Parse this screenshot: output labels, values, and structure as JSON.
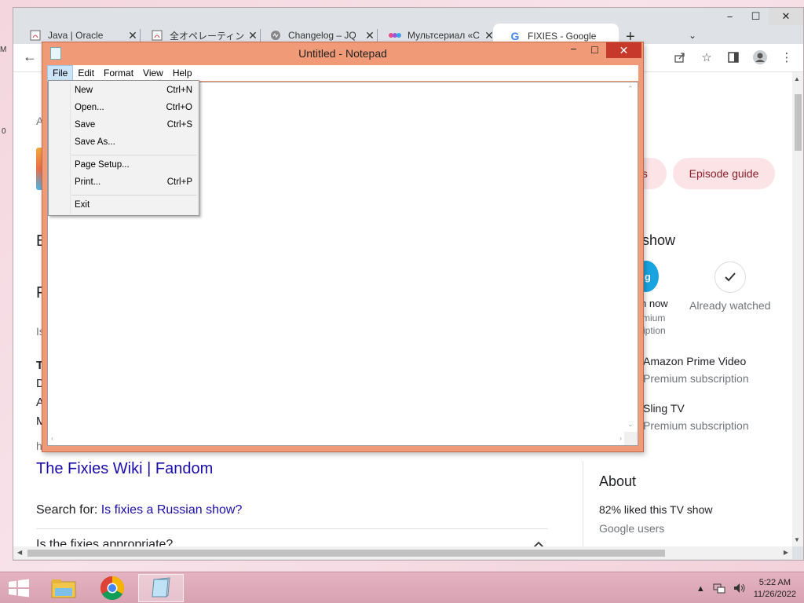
{
  "chrome": {
    "tabs": [
      {
        "title": "Java | Oracle",
        "icon": "java-icon"
      },
      {
        "title": "全オペレーティング",
        "icon": "java-icon"
      },
      {
        "title": "Changelog – JQ",
        "icon": "jquery-icon"
      },
      {
        "title": "Мультсериал «С",
        "icon": "kinopoisk-icon"
      },
      {
        "title": "FIXIES - Google",
        "icon": "google-icon"
      }
    ],
    "new_tab": "+",
    "tab_search": "⌄",
    "window_controls": {
      "min": "−",
      "max": "☐",
      "close": "✕"
    },
    "toolbar_icons": [
      "share-icon",
      "star-icon",
      "sidebar-icon",
      "profile-icon",
      "menu-icon"
    ]
  },
  "page": {
    "pill_partial": "rs",
    "pill_episode": "Episode guide",
    "watch_header": "show",
    "watch_now": "n now",
    "watch_now_sub1": "mium",
    "watch_now_sub2": "ription",
    "already_watched": "Already watched",
    "provider1_name": "Amazon Prime Video",
    "provider1_sub": "Premium subscription",
    "provider2_name": "Sling TV",
    "provider2_sub": "Premium subscription",
    "left_letters": [
      "E",
      "F",
      "Is",
      "T",
      "D",
      "A",
      "M",
      "h"
    ],
    "result_title": "The Fixies Wiki | Fandom",
    "search_for_label": "Search for:",
    "search_for_link": "Is fixies a Russian show?",
    "faq_question": "Is the fixies appropriate?",
    "about_title": "About",
    "about_stat": "82% liked this TV show",
    "about_source": "Google users",
    "left_top_a": "A"
  },
  "notepad": {
    "title": "Untitled - Notepad",
    "menu": [
      "File",
      "Edit",
      "Format",
      "View",
      "Help"
    ],
    "file_menu": [
      {
        "label": "New",
        "shortcut": "Ctrl+N"
      },
      {
        "label": "Open...",
        "shortcut": "Ctrl+O"
      },
      {
        "label": "Save",
        "shortcut": "Ctrl+S"
      },
      {
        "label": "Save As...",
        "shortcut": ""
      },
      {
        "label": "Page Setup...",
        "shortcut": ""
      },
      {
        "label": "Print...",
        "shortcut": "Ctrl+P"
      },
      {
        "label": "Exit",
        "shortcut": ""
      }
    ]
  },
  "taskbar": {
    "apps": [
      "file-explorer-icon",
      "chrome-icon",
      "notepad-icon"
    ],
    "time": "5:22 AM",
    "date": "11/26/2022"
  },
  "desktop_edge": {
    "a": "M",
    "b": "0"
  }
}
